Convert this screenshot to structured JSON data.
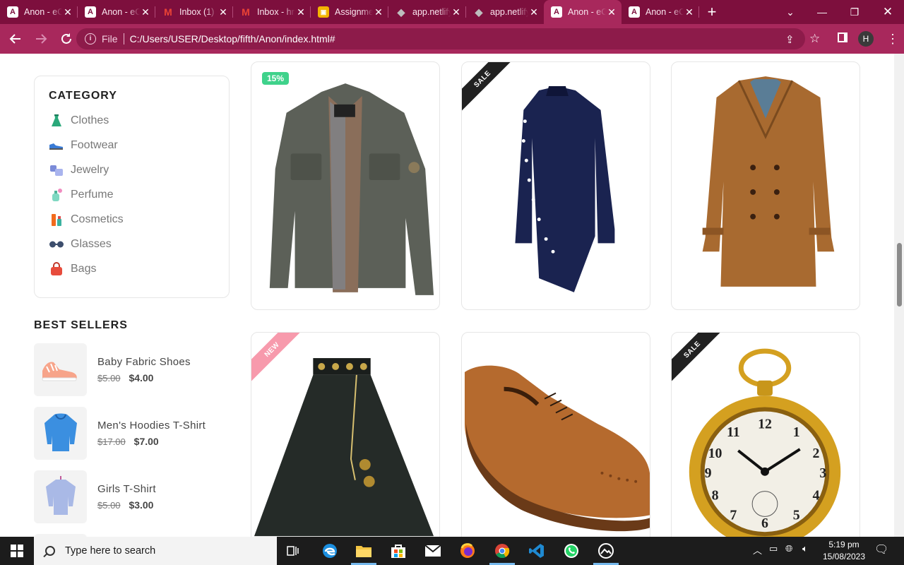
{
  "browser": {
    "tabs": [
      {
        "title": "Anon - eCommerce",
        "favicon": "anon-logo-icon"
      },
      {
        "title": "Anon - eCommerce",
        "favicon": "anon-logo-icon"
      },
      {
        "title": "Inbox (1)",
        "favicon": "gmail-icon"
      },
      {
        "title": "Inbox - hrsh",
        "favicon": "gmail-icon"
      },
      {
        "title": "Assignment",
        "favicon": "classroom-icon"
      },
      {
        "title": "app.netlify.com",
        "favicon": "netlify-icon"
      },
      {
        "title": "app.netlify.com",
        "favicon": "netlify-icon"
      },
      {
        "title": "Anon - eCommerce",
        "favicon": "anon-logo-icon",
        "active": true
      },
      {
        "title": "Anon - eCommerce",
        "favicon": "anon-logo-icon"
      }
    ],
    "new_tab_symbol": "+",
    "omnibox": {
      "scheme_label": "File",
      "url": "C:/Users/USER/Desktop/fifth/Anon/index.html#"
    },
    "profile_initial": "H",
    "colors": {
      "frame": "#7d0f3d",
      "toolbar": "#a8285c"
    }
  },
  "sidebar": {
    "category_title": "CATEGORY",
    "categories": [
      {
        "label": "Clothes",
        "icon": "dress-icon"
      },
      {
        "label": "Footwear",
        "icon": "shoe-icon"
      },
      {
        "label": "Jewelry",
        "icon": "jewelry-icon"
      },
      {
        "label": "Perfume",
        "icon": "perfume-icon"
      },
      {
        "label": "Cosmetics",
        "icon": "cosmetics-icon"
      },
      {
        "label": "Glasses",
        "icon": "glasses-icon"
      },
      {
        "label": "Bags",
        "icon": "bag-icon"
      }
    ],
    "bestsellers_title": "BEST SELLERS",
    "bestsellers": [
      {
        "name": "Baby Fabric Shoes",
        "old_price": "$5.00",
        "price": "$4.00",
        "image": "baby-shoes-image"
      },
      {
        "name": "Men's Hoodies T-Shirt",
        "old_price": "$17.00",
        "price": "$7.00",
        "image": "hoodie-image"
      },
      {
        "name": "Girls T-Shirt",
        "old_price": "$5.00",
        "price": "$3.00",
        "image": "girls-tshirt-image"
      }
    ]
  },
  "products": [
    {
      "image": "jacket-image",
      "badge": "15%",
      "badge_type": "percent"
    },
    {
      "image": "shirt-image",
      "badge": "SALE",
      "badge_type": "sale"
    },
    {
      "image": "coat-image",
      "badge": "",
      "badge_type": "none"
    },
    {
      "image": "skirt-image",
      "badge": "NEW",
      "badge_type": "new"
    },
    {
      "image": "leather-shoe-image",
      "badge": "",
      "badge_type": "none"
    },
    {
      "image": "pocket-watch-image",
      "badge": "SALE",
      "badge_type": "sale"
    }
  ],
  "taskbar": {
    "search_placeholder": "Type here to search",
    "time": "5:19 pm",
    "date": "15/08/2023"
  }
}
